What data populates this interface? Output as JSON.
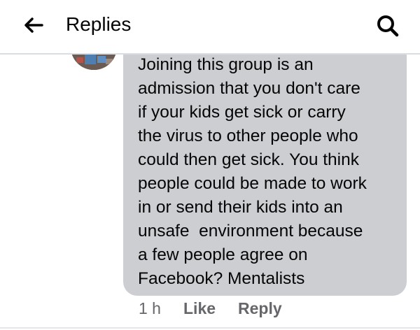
{
  "header": {
    "title": "Replies",
    "back_icon": "arrow-left-icon",
    "search_icon": "search-icon"
  },
  "comment": {
    "lines": [
      "Joining this group is an",
      "admission that you don't care",
      "if your kids get sick or carry",
      "the virus to other people who",
      "could then get sick. You think",
      "people could be made to work",
      "in or send their kids into an",
      "unsafe  environment because",
      "a few people agree on",
      "Facebook? Mentalists"
    ],
    "time": "1 h",
    "like_label": "Like",
    "reply_label": "Reply"
  },
  "colors": {
    "bubble": "#ccced2",
    "text": "#050505",
    "meta": "#65676b",
    "divider": "#dadde1"
  }
}
